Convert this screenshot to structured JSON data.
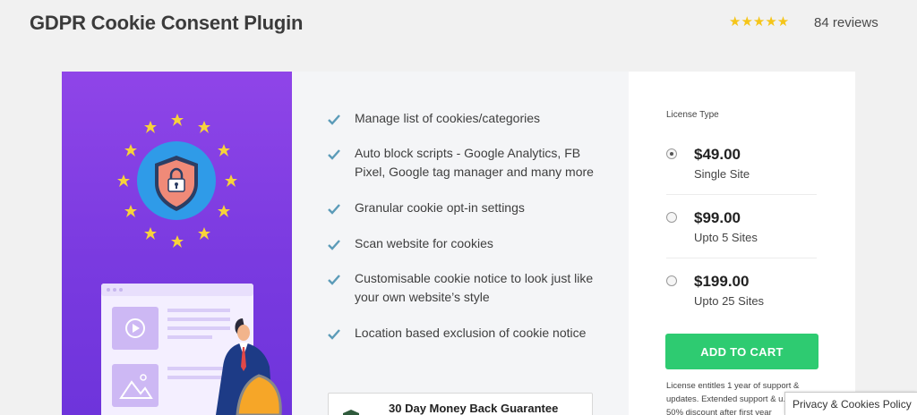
{
  "header": {
    "title": "GDPR Cookie Consent Plugin",
    "stars": "★★★★★",
    "rating": 5,
    "reviews": "84 reviews"
  },
  "features": [
    {
      "text": "Manage list of cookies/categories"
    },
    {
      "text": "Auto block scripts - Google Analytics, FB Pixel, Google tag manager and many more"
    },
    {
      "text": "Granular cookie opt-in settings"
    },
    {
      "text": "Scan website for cookies"
    },
    {
      "text": "Customisable cookie notice to look just like your own website’s style"
    },
    {
      "text": "Location based exclusion of cookie notice"
    }
  ],
  "guarantee": {
    "text": "30 Day Money Back Guarantee"
  },
  "pricing": {
    "license_label": "License Type",
    "plans": [
      {
        "price": "$49.00",
        "sites": "Single Site",
        "selected": true
      },
      {
        "price": "$99.00",
        "sites": "Upto 5 Sites",
        "selected": false
      },
      {
        "price": "$199.00",
        "sites": "Upto 25 Sites",
        "selected": false
      }
    ],
    "cart_label": "ADD TO CART",
    "note": "License entitles 1 year of support & updates. Extended support & u... at 50% discount after first year"
  },
  "privacy_label": "Privacy & Cookies Policy",
  "colors": {
    "accent_green": "#2ecb71",
    "hero_purple": "#7a3ae0",
    "check_blue": "#5b9bb8",
    "star_gold": "#f5c518"
  },
  "icons": [
    "star-rating-icon",
    "eu-shield-lock-icon",
    "checkmark-icon",
    "browser-mockup-illustration",
    "shield-badge-icon"
  ]
}
